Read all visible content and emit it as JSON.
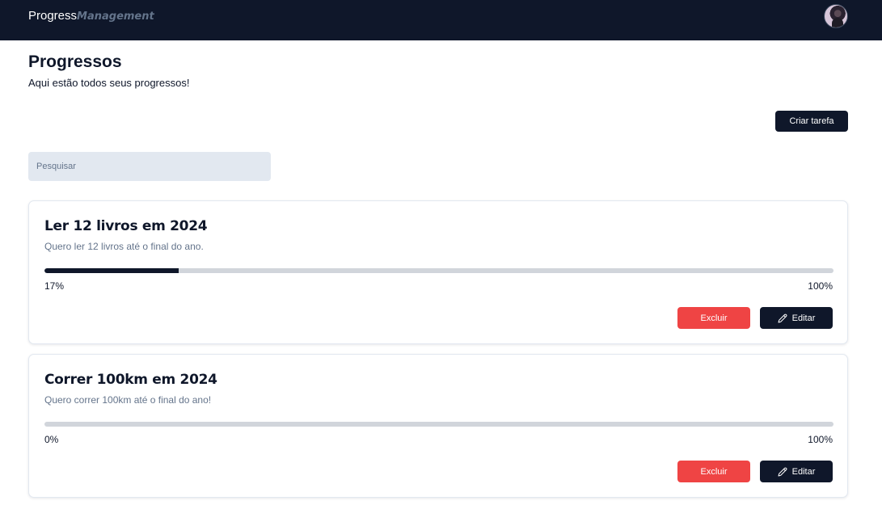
{
  "navbar": {
    "brand_part1": "Progress",
    "brand_part2": "Management",
    "avatar_icon": "user-avatar"
  },
  "header": {
    "title": "Progressos",
    "subtitle": "Aqui estão todos seus progressos!"
  },
  "actions": {
    "create_label": "Criar tarefa"
  },
  "search": {
    "placeholder": "Pesquisar",
    "value": ""
  },
  "tasks": [
    {
      "title": "Ler 12 livros em 2024",
      "description": "Quero ler 12 livros até o final do ano.",
      "progress": 17,
      "progress_label": "17%",
      "max_label": "100%",
      "delete_label": "Excluir",
      "edit_label": "Editar"
    },
    {
      "title": "Correr 100km em 2024",
      "description": "Quero correr 100km até o final do ano!",
      "progress": 0,
      "progress_label": "0%",
      "max_label": "100%",
      "delete_label": "Excluir",
      "edit_label": "Editar"
    }
  ],
  "colors": {
    "navbar": "#0f172a",
    "accent_muted": "#64748b",
    "danger": "#ef4444",
    "search_bg": "#e2e8f0",
    "track": "#d1d5db"
  },
  "icons": {
    "edit": "pencil-icon"
  }
}
